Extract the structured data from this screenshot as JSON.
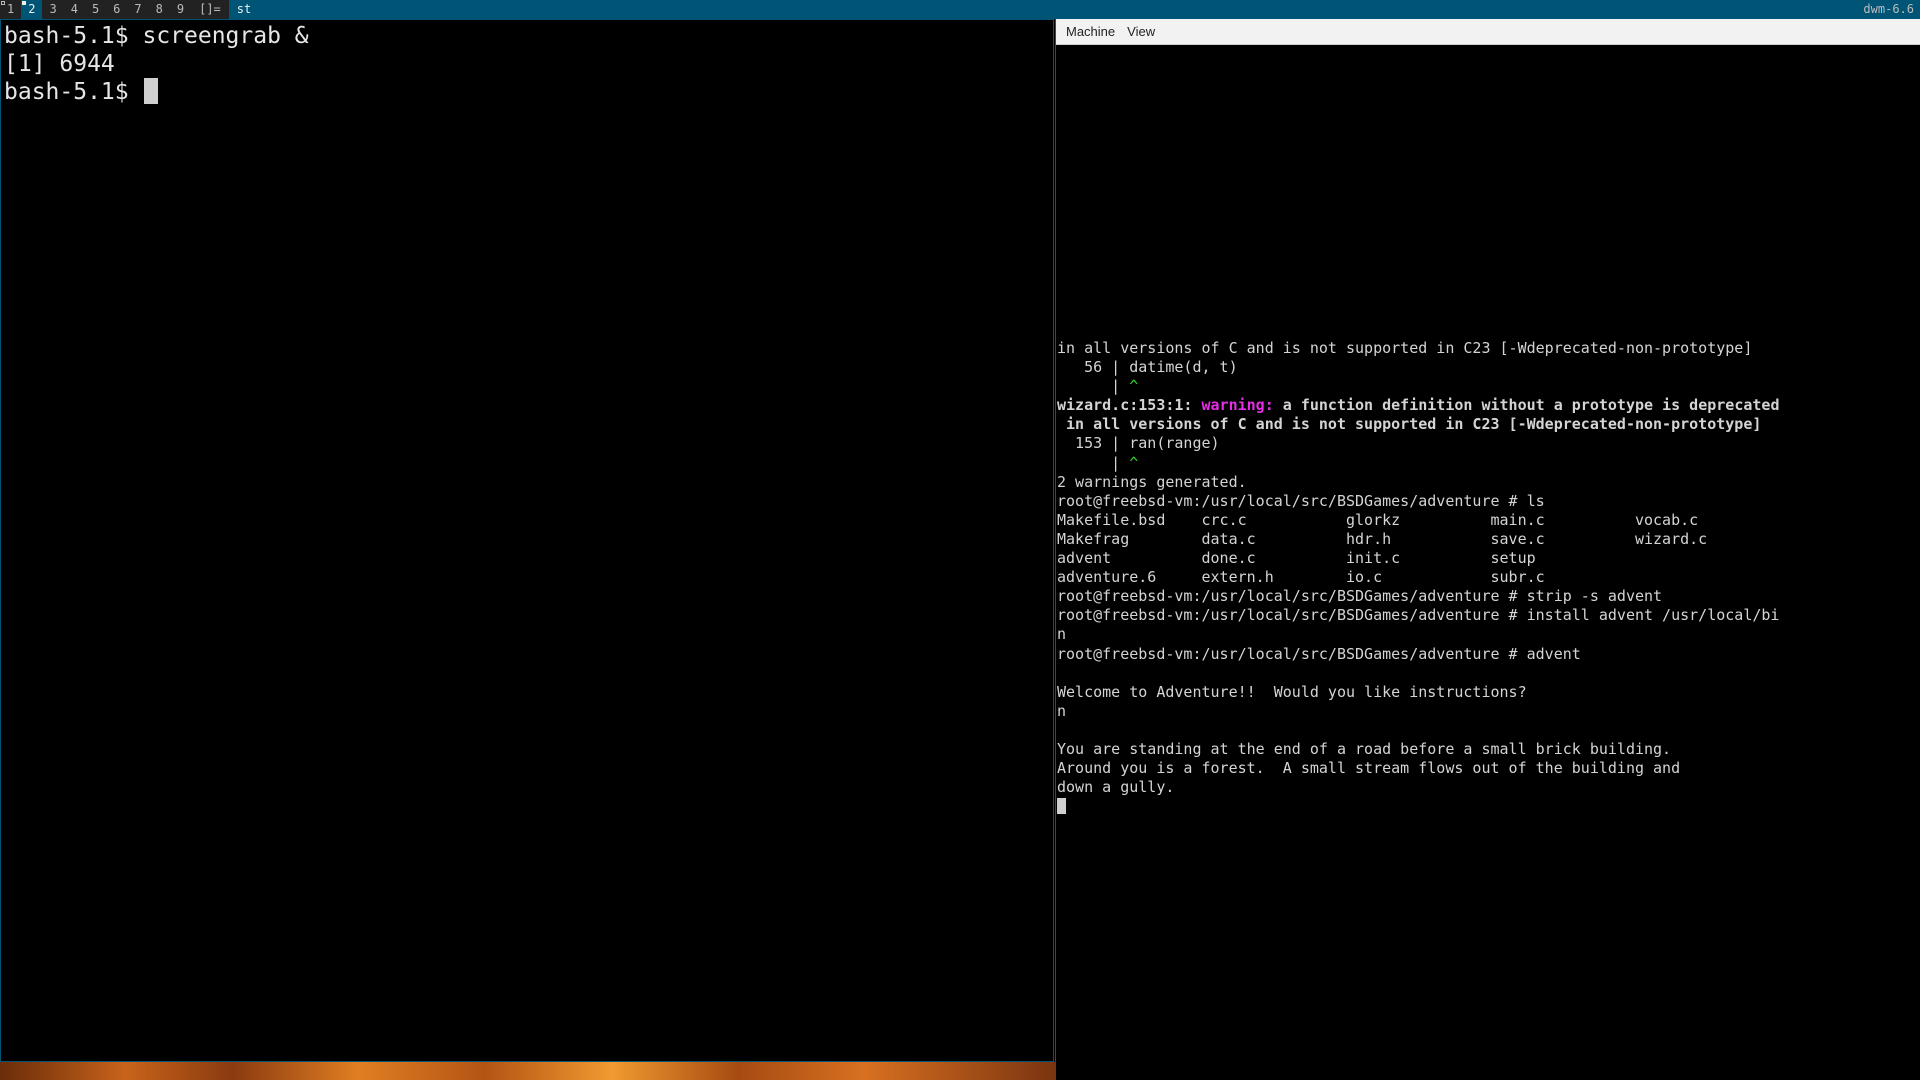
{
  "bar": {
    "tags": [
      {
        "label": "1",
        "selected": false,
        "occupied": true
      },
      {
        "label": "2",
        "selected": true,
        "occupied": true
      },
      {
        "label": "3",
        "selected": false,
        "occupied": false
      },
      {
        "label": "4",
        "selected": false,
        "occupied": false
      },
      {
        "label": "5",
        "selected": false,
        "occupied": false
      },
      {
        "label": "6",
        "selected": false,
        "occupied": false
      },
      {
        "label": "7",
        "selected": false,
        "occupied": false
      },
      {
        "label": "8",
        "selected": false,
        "occupied": false
      },
      {
        "label": "9",
        "selected": false,
        "occupied": false
      }
    ],
    "layout_symbol": "[]=",
    "window_title": "st",
    "status": "dwm-6.6"
  },
  "terminal": {
    "lines": [
      "bash-5.1$ screengrab &",
      "[1] 6944"
    ],
    "prompt": "bash-5.1$ "
  },
  "vm": {
    "menu": {
      "machine": "Machine",
      "view": "View"
    },
    "console": {
      "l01": "in all versions of C and is not supported in C23 [-Wdeprecated-non-prototype]",
      "l02_gutter": "   56 | ",
      "l02_code": "datime(d, t)",
      "l03_gutter": "      | ",
      "l03_caret": "^",
      "l04_loc": "wizard.c:153:1: ",
      "l04_warn": "warning:",
      "l04_msg": " a function definition without a prototype is deprecated",
      "l05": " in all versions of C and is not supported in C23 [-Wdeprecated-non-prototype]",
      "l06_gutter": "  153 | ",
      "l06_code": "ran(range)",
      "l07_gutter": "      | ",
      "l07_caret": "^",
      "l08": "2 warnings generated.",
      "l09": "root@freebsd-vm:/usr/local/src/BSDGames/adventure # ls",
      "l10": "Makefile.bsd    crc.c           glorkz          main.c          vocab.c",
      "l11": "Makefrag        data.c          hdr.h           save.c          wizard.c",
      "l12": "advent          done.c          init.c          setup",
      "l13": "adventure.6     extern.h        io.c            subr.c",
      "l14": "root@freebsd-vm:/usr/local/src/BSDGames/adventure # strip -s advent",
      "l15": "root@freebsd-vm:/usr/local/src/BSDGames/adventure # install advent /usr/local/bi",
      "l16": "n",
      "l17": "root@freebsd-vm:/usr/local/src/BSDGames/adventure # advent",
      "l18": "",
      "l19": "Welcome to Adventure!!  Would you like instructions?",
      "l20": "n",
      "l21": "",
      "l22": "You are standing at the end of a road before a small brick building.",
      "l23": "Around you is a forest.  A small stream flows out of the building and",
      "l24": "down a gully."
    }
  }
}
